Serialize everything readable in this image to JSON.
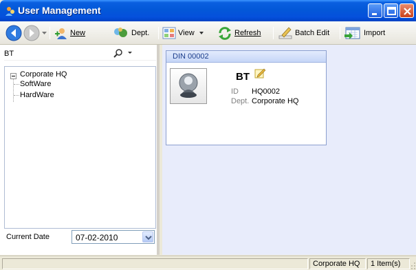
{
  "window": {
    "title": "User Management",
    "controls": [
      "minimize",
      "maximize",
      "close"
    ]
  },
  "toolbar": {
    "new_label": "New",
    "dept_label": "Dept.",
    "view_label": "View",
    "refresh_label": "Refresh",
    "batch_edit_label": "Batch Edit",
    "import_label": "Import"
  },
  "search": {
    "value": "BT"
  },
  "tree": {
    "root": "Corporate HQ",
    "children": [
      "SoftWare",
      "HardWare"
    ]
  },
  "date_filter": {
    "label": "Current Date",
    "value": "07-02-2010"
  },
  "card": {
    "header": "DIN 00002",
    "name": "BT",
    "id_label": "ID",
    "id_value": "HQ0002",
    "dept_label": "Dept.",
    "dept_value": "Corporate HQ"
  },
  "status": {
    "department": "Corporate HQ",
    "count": "1 Item(s)"
  },
  "colors": {
    "titlebar": "#0358d8",
    "main_bg": "#e8ecfb",
    "card_border": "#8b9fcf"
  }
}
